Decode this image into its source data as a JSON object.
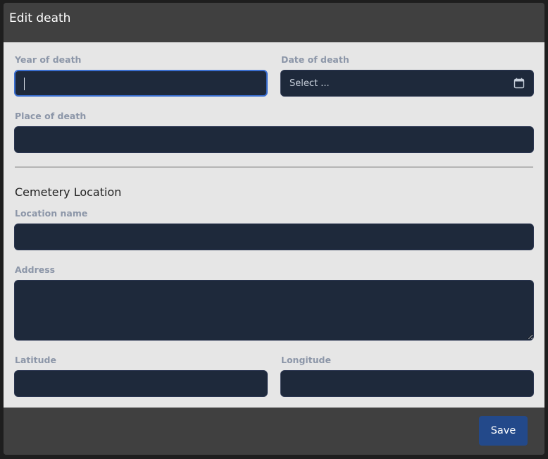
{
  "dialog": {
    "title": "Edit death"
  },
  "form": {
    "year_of_death": {
      "label": "Year of death",
      "value": ""
    },
    "date_of_death": {
      "label": "Date of death",
      "placeholder": "Select ...",
      "icon": "calendar-icon"
    },
    "place_of_death": {
      "label": "Place of death",
      "value": ""
    }
  },
  "cemetery": {
    "section_title": "Cemetery Location",
    "location_name": {
      "label": "Location name",
      "value": ""
    },
    "address": {
      "label": "Address",
      "value": ""
    },
    "latitude": {
      "label": "Latitude",
      "value": ""
    },
    "longitude": {
      "label": "Longitude",
      "value": ""
    }
  },
  "footer": {
    "save_label": "Save"
  },
  "colors": {
    "field_bg": "#1e293b",
    "focus_border": "#3b6fd1",
    "save_button": "#23498a",
    "body_bg": "#e6e6e6",
    "chrome_bg": "#404040"
  }
}
